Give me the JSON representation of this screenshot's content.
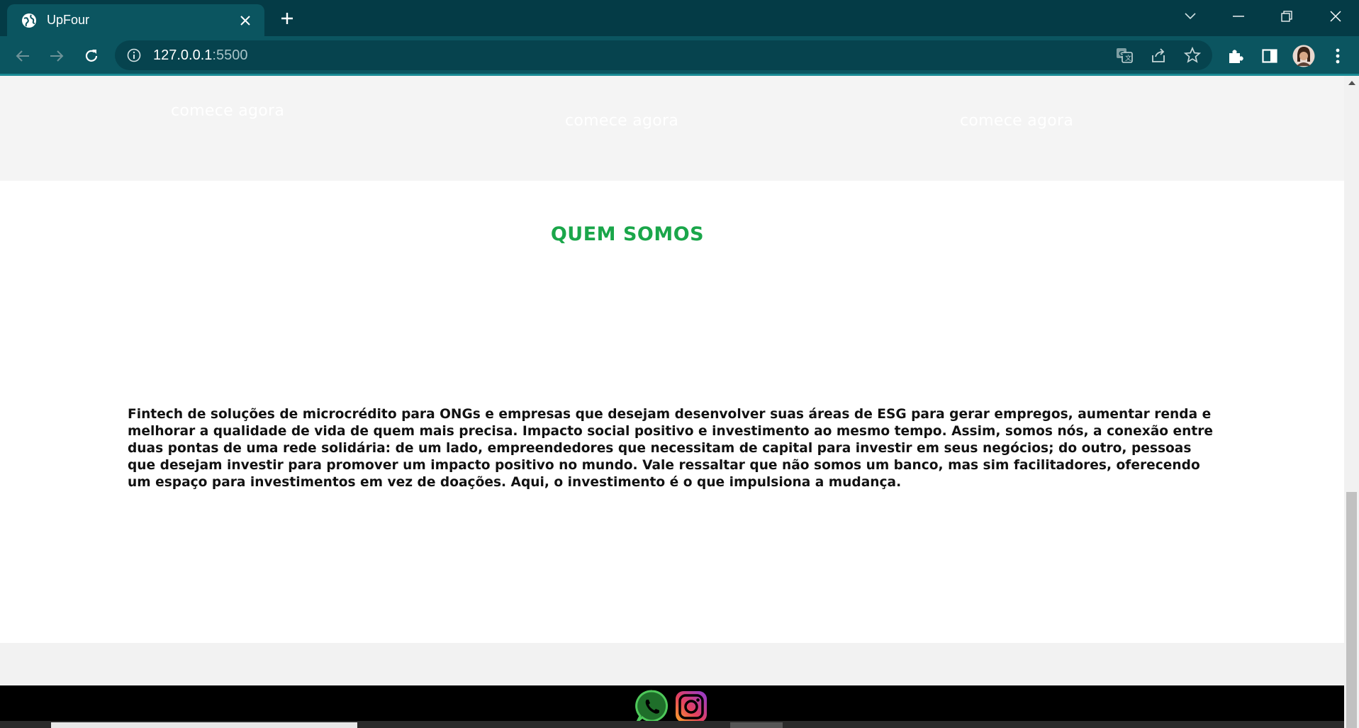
{
  "browser": {
    "tab_title": "UpFour",
    "url_host": "127.0.0.1",
    "url_port": ":5500"
  },
  "cards": {
    "cta_label_1": "comece agora",
    "cta_label_2": "comece agora",
    "cta_label_3": "comece agora"
  },
  "about": {
    "heading": "QUEM SOMOS",
    "body": "Fintech de soluções de microcrédito para ONGs e empresas que desejam desenvolver suas áreas de ESG para gerar empregos, aumentar renda e melhorar a qualidade de vida de quem mais precisa. Impacto social positivo e investimento ao mesmo tempo. Assim, somos nós, a conexão entre duas pontas de uma rede solidária: de um lado, empreendedores que necessitam de capital para investir em seus negócios; do outro, pessoas que desejam investir para promover um impacto positivo no mundo. Vale ressaltar que não somos um banco, mas sim facilitadores, oferecendo um espaço para investimentos em vez de doações. Aqui, o investimento é o que impulsiona a mudança."
  },
  "footer": {
    "social_icons": [
      "whatsapp-icon",
      "instagram-icon"
    ]
  },
  "colors": {
    "chrome_dark": "#043b46",
    "chrome_toolbar": "#0b5560",
    "heading_green": "#1aa64a",
    "footer_bg": "#000000"
  }
}
